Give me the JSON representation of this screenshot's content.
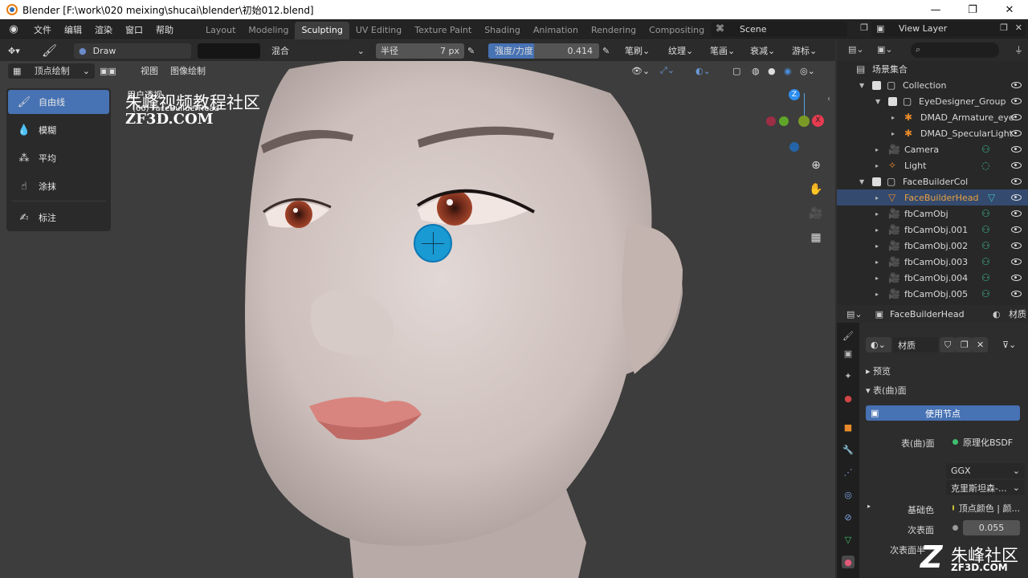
{
  "titlebar": {
    "title": "Blender [F:\\work\\020 meixing\\shucai\\blender\\初始012.blend]",
    "minimize": "—",
    "maximize": "❐",
    "close": "✕"
  },
  "menu": {
    "items": [
      "文件",
      "编辑",
      "渲染",
      "窗口",
      "帮助"
    ],
    "workspaces": [
      "Layout",
      "Modeling",
      "Sculpting",
      "UV Editing",
      "Texture Paint",
      "Shading",
      "Animation",
      "Rendering",
      "Compositing",
      "Sc"
    ],
    "active_workspace": "Sculpting",
    "scene": "Scene",
    "view_layer": "View Layer"
  },
  "toolheader": {
    "brush_name": "Draw",
    "blend_mode": "混合",
    "radius_label": "半径",
    "radius_value": "7 px",
    "strength_label": "强度/力度",
    "strength_value": "0.414",
    "strength_fraction": 0.414,
    "menus": [
      "笔刷",
      "纹理",
      "笔画",
      "衰减",
      "游标"
    ]
  },
  "modebar": {
    "mode": "顶点绘制",
    "view": "视图",
    "image_paint": "图像绘制"
  },
  "toolbar": {
    "tools": [
      {
        "label": "自由线",
        "icon": "brush-icon",
        "active": true
      },
      {
        "label": "模糊",
        "icon": "drop-icon",
        "active": false
      },
      {
        "label": "平均",
        "icon": "average-icon",
        "active": false
      },
      {
        "label": "涂抹",
        "icon": "smear-icon",
        "active": false
      },
      {
        "label": "标注",
        "icon": "annotate-icon",
        "active": false
      }
    ]
  },
  "viewport": {
    "overlay_text_1": "用户透视",
    "overlay_text_2": "(66) FaceBuilderHead",
    "watermark_cn": "朱峰视频教程社区",
    "watermark_en": "ZF3D.COM",
    "watermark2_cn": "朱峰社区",
    "watermark2_en": "ZF3D.COM"
  },
  "outliner": {
    "root": "场景集合",
    "rows": [
      {
        "label": "Collection",
        "indent": 1,
        "type": "collection"
      },
      {
        "label": "EyeDesigner_Group",
        "indent": 2,
        "type": "collection"
      },
      {
        "label": "DMAD_Armature_eye",
        "indent": 3,
        "type": "armature"
      },
      {
        "label": "DMAD_SpecularLight",
        "indent": 3,
        "type": "armature"
      },
      {
        "label": "Camera",
        "indent": 2,
        "type": "camera"
      },
      {
        "label": "Light",
        "indent": 2,
        "type": "light"
      },
      {
        "label": "FaceBuilderCol",
        "indent": 1,
        "type": "collection"
      },
      {
        "label": "FaceBuilderHead",
        "indent": 2,
        "type": "mesh",
        "selected": true
      },
      {
        "label": "fbCamObj",
        "indent": 2,
        "type": "camera"
      },
      {
        "label": "fbCamObj.001",
        "indent": 2,
        "type": "camera"
      },
      {
        "label": "fbCamObj.002",
        "indent": 2,
        "type": "camera"
      },
      {
        "label": "fbCamObj.003",
        "indent": 2,
        "type": "camera"
      },
      {
        "label": "fbCamObj.004",
        "indent": 2,
        "type": "camera"
      },
      {
        "label": "fbCamObj.005",
        "indent": 2,
        "type": "camera"
      }
    ]
  },
  "properties": {
    "object_name": "FaceBuilderHead",
    "tab_label": "材质",
    "material_name": "材质",
    "preview": "预览",
    "surface_panel": "表(曲)面",
    "use_nodes": "使用节点",
    "surface_label": "表(曲)面",
    "surface_value": "原理化BSDF",
    "distribution": "GGX",
    "subsurface_method": "克里斯坦森-...",
    "base_color_label": "基础色",
    "base_color_value": "顶点颜色 | 颜...",
    "subsurface_label": "次表面",
    "subsurface_value": "0.055",
    "subsurface_radius_label": "次表面半"
  },
  "colors": {
    "accent": "#4772b3",
    "selected_row": "#344a6e",
    "background": "#3d3d3d"
  }
}
